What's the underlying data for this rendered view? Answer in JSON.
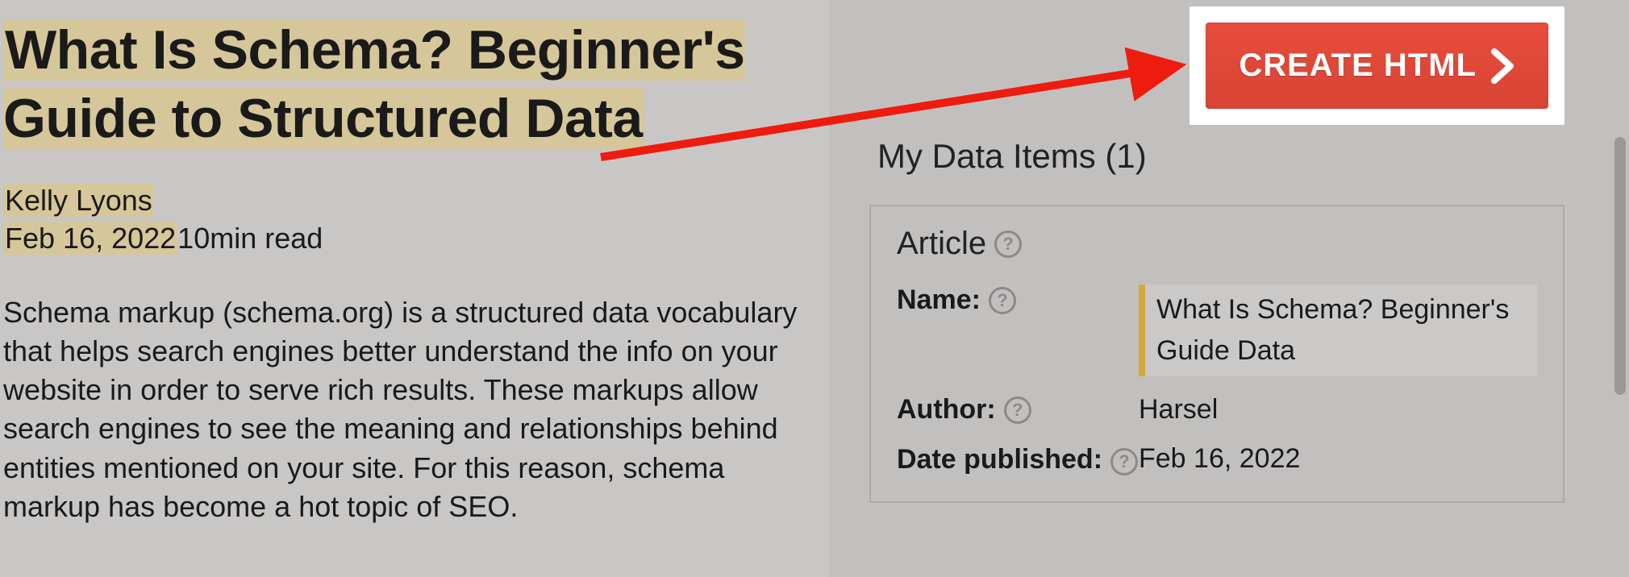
{
  "article": {
    "title": "What Is Schema? Beginner's Guide to Structured Data",
    "author": "Kelly Lyons",
    "date": "Feb 16, 2022",
    "read_time": "10min read",
    "body": "Schema markup (schema.org) is a structured data vocabulary that helps search engines better understand the info on your website in order to serve rich results. These markups allow search engines to see the meaning and relationships behind entities mentioned on your site. For this reason, schema markup has become a hot topic of SEO."
  },
  "right_panel": {
    "create_button_label": "CREATE HTML",
    "panel_title": "My Data Items (1)",
    "card": {
      "type": "Article",
      "fields": {
        "name": {
          "label": "Name:",
          "value": "What Is Schema? Beginner's Guide Data"
        },
        "author": {
          "label": "Author:",
          "value": "Harsel"
        },
        "date_published": {
          "label": "Date published:",
          "value": "Feb 16, 2022"
        }
      }
    }
  }
}
